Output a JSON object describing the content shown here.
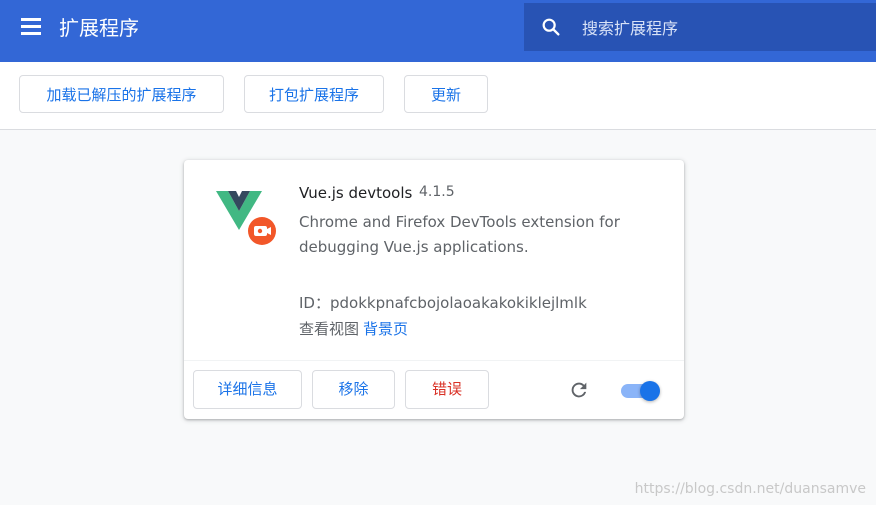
{
  "header": {
    "menu_icon": "hamburger-menu-icon",
    "title": "扩展程序",
    "search": {
      "placeholder": "搜索扩展程序",
      "value": "",
      "icon": "search-icon"
    }
  },
  "toolbar": {
    "load_unpacked": "加载已解压的扩展程序",
    "pack": "打包扩展程序",
    "update": "更新"
  },
  "extension": {
    "name": "Vue.js devtools",
    "version": "4.1.5",
    "description": "Chrome and Firefox DevTools extension for debugging Vue.js applications.",
    "id_text": "ID：pdokkpnafcbojolaoakakokiklejlmlk",
    "views_label": "查看视图",
    "views_link": "背景页",
    "details_button": "详细信息",
    "remove_button": "移除",
    "errors_button": "错误",
    "enabled": true
  },
  "watermark": "https://blog.csdn.net/duansamve",
  "colors": {
    "header_bg": "#3367d6",
    "search_bg": "#2853b4",
    "accent": "#1a73e8",
    "error": "#d93025",
    "page_bg": "#f8f9fa"
  }
}
